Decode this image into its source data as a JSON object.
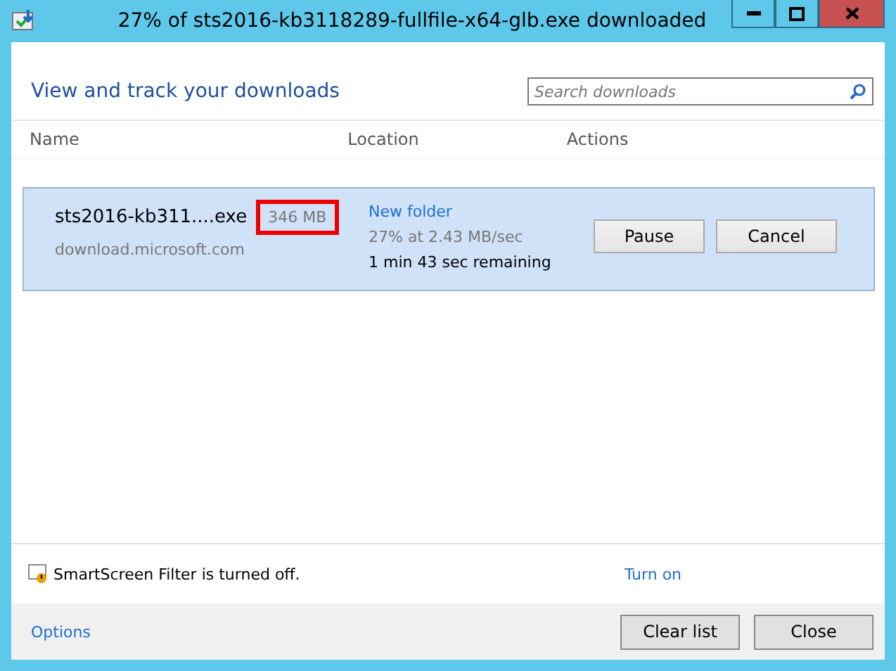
{
  "window": {
    "title": "27% of sts2016-kb3118289-fullfile-x64-glb.exe downloaded"
  },
  "heading": "View and track your downloads",
  "search": {
    "placeholder": "Search downloads"
  },
  "columns": [
    "Name",
    "Location",
    "Actions"
  ],
  "downloads": [
    {
      "name": "sts2016-kb311....exe",
      "source": "download.microsoft.com",
      "size": "346 MB",
      "size_highlighted": true,
      "folder": "New folder",
      "progress": "27% at 2.43 MB/sec",
      "remaining": "1 min 43 sec remaining",
      "selected": true,
      "buttons": [
        "Pause",
        "Cancel"
      ]
    }
  ],
  "smartscreen": {
    "message": "SmartScreen Filter is turned off.",
    "link": "Turn on"
  },
  "footer": {
    "options": "Options",
    "buttons": [
      "Clear list",
      "Close"
    ]
  }
}
